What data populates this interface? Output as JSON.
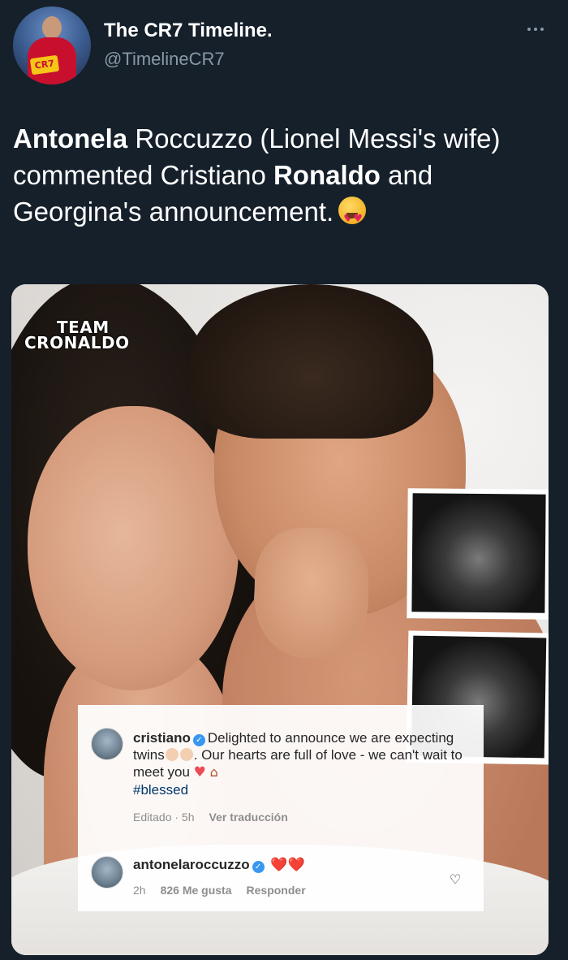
{
  "tweet": {
    "display_name": "The CR7 Timeline.",
    "handle": "@TimelineCR7",
    "avatar_badge": "CR7",
    "text": {
      "bold_1": "Antonela",
      "part_1": " Roccuzzo (Lionel Messi's wife) commented Cristiano ",
      "bold_2": "Ronaldo",
      "part_2": " and Georgina's announcement.",
      "emoji": "heart-eyes-emoji"
    }
  },
  "media": {
    "watermark_line_1": "TEAM",
    "watermark_line_2": "CRONALDO",
    "ig_comments": [
      {
        "user": "cristiano",
        "text_1": "Delighted to announce we are expecting twins",
        "text_2": ". Our hearts are full of love - we can't wait to meet you",
        "hashtag": "#blessed",
        "meta_edited": "Editado · 5h",
        "meta_translate": "Ver traducción"
      },
      {
        "user": "antonelaroccuzzo",
        "text": "❤️❤️",
        "meta_time": "2h",
        "meta_likes": "826 Me gusta",
        "meta_reply": "Responder"
      }
    ]
  },
  "colors": {
    "background": "#15202b",
    "secondary_text": "#8899a6",
    "ig_verified": "#3897f0",
    "heart": "#ed4956"
  }
}
